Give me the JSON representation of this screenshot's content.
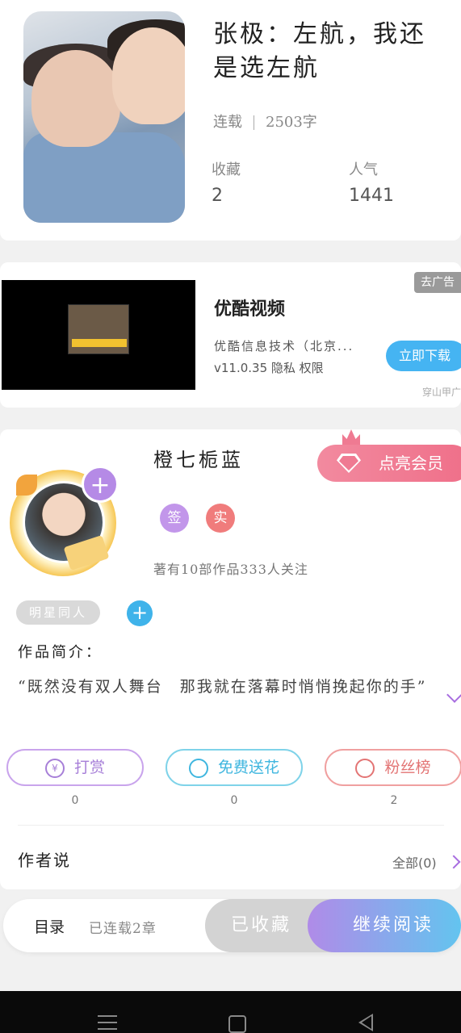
{
  "book": {
    "title": "张极：左航，我还是选左航",
    "status": "连载",
    "word_count": "2503字",
    "favorites_label": "收藏",
    "favorites_value": "2",
    "popularity_label": "人气",
    "popularity_value": "1441"
  },
  "ad": {
    "tag": "去广告",
    "app_name": "优酷视频",
    "company": "优酷信息技术（北京...",
    "version_line": "v11.0.35 隐私 权限",
    "download_label": "立即下载",
    "source": "穿山甲广"
  },
  "author": {
    "name": "橙七栀蓝",
    "vip_label": "点亮会员",
    "badge_sign": "签",
    "badge_real": "实",
    "stats": "著有10部作品333人关注",
    "tag": "明星同人",
    "tag_add": "+",
    "avatar_plus": "+"
  },
  "intro": {
    "label": "作品简介：",
    "text": "“既然没有双人舞台　那我就在落幕时悄悄挽起你的手”"
  },
  "actions": {
    "reward_label": "打赏",
    "reward_icon": "¥",
    "reward_count": "0",
    "flower_label": "免费送花",
    "flower_count": "0",
    "fans_label": "粉丝榜",
    "fans_count": "2"
  },
  "author_says": {
    "label": "作者说",
    "all_label": "全部(0)"
  },
  "bottom": {
    "toc_label": "目录",
    "toc_count": "已连载2章",
    "collected_label": "已收藏",
    "continue_label": "继续阅读"
  },
  "colors": {
    "accent_purple": "#b08be8",
    "accent_blue": "#45b4f2",
    "vip_pink": "#ef6f89"
  }
}
